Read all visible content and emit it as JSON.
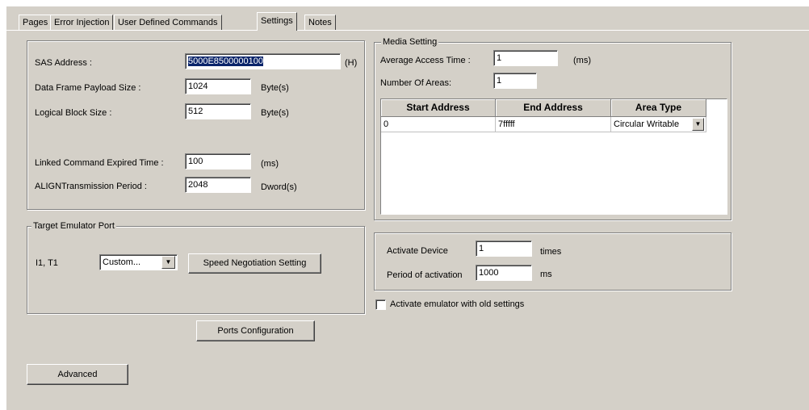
{
  "tabs": [
    {
      "label": "Pages"
    },
    {
      "label": "Error Injection"
    },
    {
      "label": "User Defined Commands"
    },
    {
      "label": "Settings"
    },
    {
      "label": "Notes"
    }
  ],
  "active_tab": "Settings",
  "general": {
    "sas_address_label": "SAS Address :",
    "sas_address_value": "5000E8500000100",
    "sas_address_unit": "(H)",
    "payload_label": "Data Frame Payload Size :",
    "payload_value": "1024",
    "payload_unit": "Byte(s)",
    "block_label": "Logical Block Size :",
    "block_value": "512",
    "block_unit": "Byte(s)",
    "linked_label": "Linked Command Expired Time :",
    "linked_value": "100",
    "linked_unit": "(ms)",
    "align_label": "ALIGNTransmission Period :",
    "align_value": "2048",
    "align_unit": "Dword(s)"
  },
  "media": {
    "title": "Media Setting",
    "access_label": "Average Access Time :",
    "access_value": "1",
    "access_unit": "(ms)",
    "areas_label": "Number Of Areas:",
    "areas_value": "1",
    "columns": [
      "Start Address",
      "End Address",
      "Area Type"
    ],
    "rows": [
      {
        "start": "0",
        "end": "7fffff",
        "type": "Circular Writable"
      }
    ]
  },
  "port": {
    "title": "Target Emulator Port",
    "port_label": "I1, T1",
    "port_value": "Custom...",
    "speed_button": "Speed Negotiation Setting"
  },
  "activation": {
    "device_label": "Activate Device",
    "device_value": "1",
    "device_unit": "times",
    "period_label": "Period of activation",
    "period_value": "1000",
    "period_unit": "ms",
    "old_settings_label": "Activate emulator with old settings",
    "old_settings_checked": false
  },
  "buttons": {
    "ports_config": "Ports Configuration",
    "advanced": "Advanced"
  }
}
